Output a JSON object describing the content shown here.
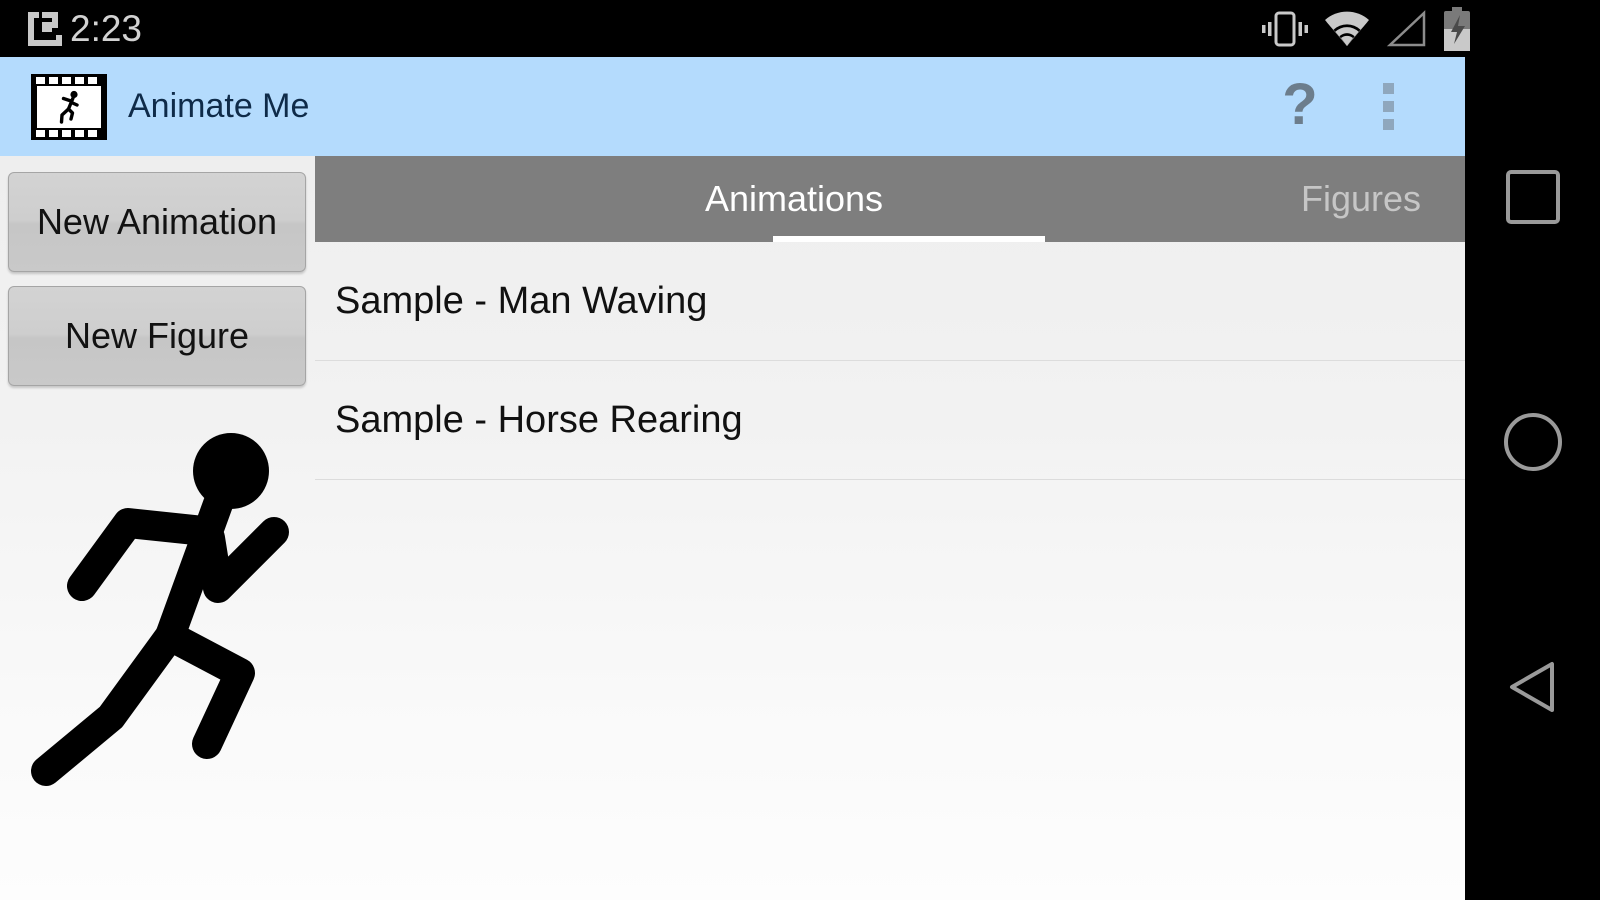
{
  "status_bar": {
    "clock": "2:23",
    "left_icons": [
      {
        "name": "app-notification-icon"
      }
    ],
    "right_icons": [
      {
        "name": "vibrate-icon"
      },
      {
        "name": "wifi-icon"
      },
      {
        "name": "cell-signal-icon"
      },
      {
        "name": "battery-charging-icon"
      }
    ]
  },
  "action_bar": {
    "app_icon_name": "film-strip-running-man-icon",
    "title": "Animate Me",
    "help_label": "?",
    "help_icon_name": "help-question-mark-icon",
    "overflow_icon_name": "overflow-menu-icon",
    "background_color": "#b4dbfd",
    "title_color": "#0f2b49"
  },
  "sidebar": {
    "buttons": [
      {
        "label": "New Animation",
        "name": "new-animation-button"
      },
      {
        "label": "New Figure",
        "name": "new-figure-button"
      }
    ],
    "preview_icon_name": "running-stick-figure-preview"
  },
  "tabs": {
    "background_color": "#7e7e7e",
    "selected_index": 0,
    "items": [
      {
        "label": "Animations",
        "selected": true
      },
      {
        "label": "Figures",
        "selected": false
      }
    ]
  },
  "list": {
    "items": [
      {
        "label": "Sample - Man Waving"
      },
      {
        "label": "Sample - Horse Rearing"
      }
    ]
  },
  "nav_bar": {
    "buttons": [
      {
        "name": "recents-button",
        "icon": "square-icon"
      },
      {
        "name": "home-button",
        "icon": "circle-icon"
      },
      {
        "name": "back-button",
        "icon": "triangle-left-icon"
      }
    ]
  }
}
